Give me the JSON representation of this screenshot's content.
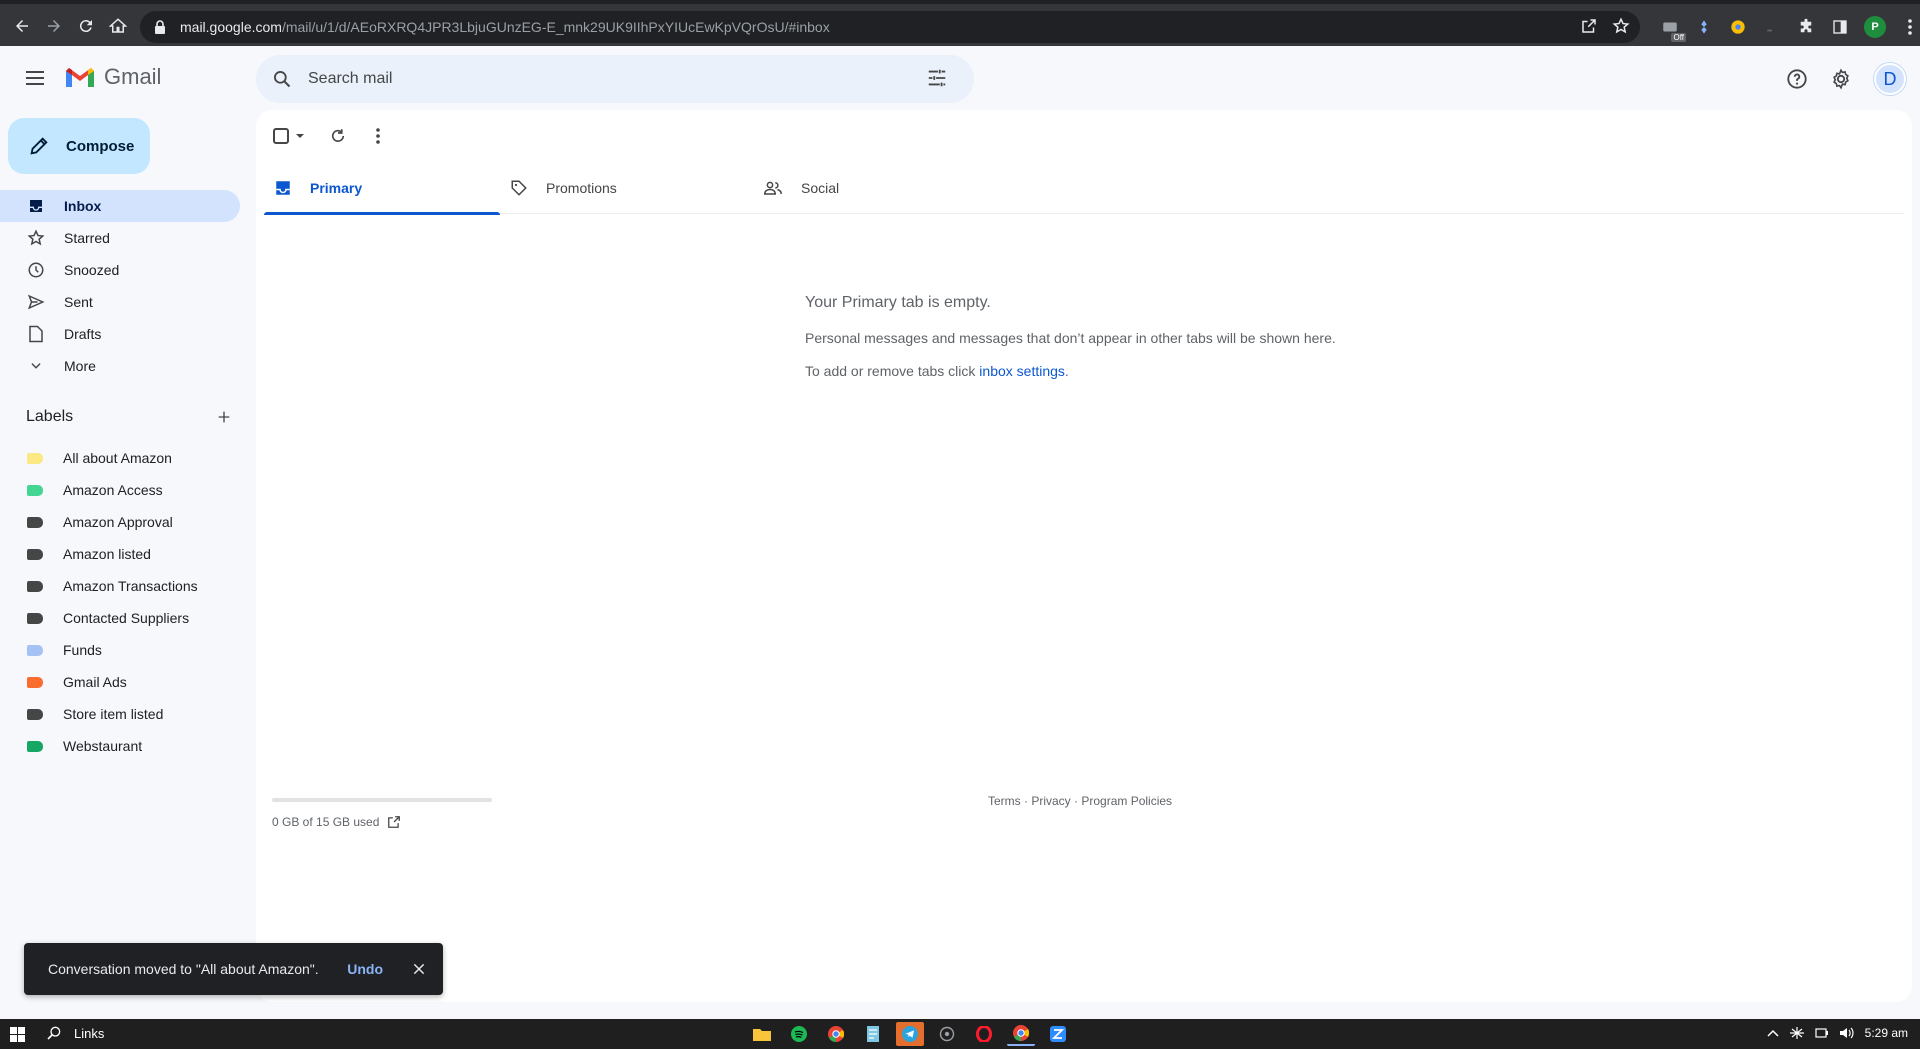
{
  "browser": {
    "url_host": "mail.google.com",
    "url_path": "/mail/u/1/d/AEoRXRQ4JPR3LbjuGUnzEG-E_mnk29UK9IIhPxYIUcEwKpVQrOsU/#inbox",
    "profile_initial": "P",
    "ext_badge": "Off"
  },
  "header": {
    "app_name": "Gmail",
    "search_placeholder": "Search mail",
    "avatar_initial": "D"
  },
  "sidebar": {
    "compose_label": "Compose",
    "items": [
      {
        "label": "Inbox",
        "icon": "inbox-icon",
        "active": true
      },
      {
        "label": "Starred",
        "icon": "star-icon"
      },
      {
        "label": "Snoozed",
        "icon": "clock-icon"
      },
      {
        "label": "Sent",
        "icon": "send-icon"
      },
      {
        "label": "Drafts",
        "icon": "draft-icon"
      },
      {
        "label": "More",
        "icon": "chevron-down-icon"
      }
    ],
    "labels_title": "Labels",
    "labels": [
      {
        "label": "All about Amazon",
        "color": "#fbe983"
      },
      {
        "label": "Amazon Access",
        "color": "#42d692"
      },
      {
        "label": "Amazon Approval",
        "color": "#444746"
      },
      {
        "label": "Amazon listed",
        "color": "#444746"
      },
      {
        "label": "Amazon Transactions",
        "color": "#444746"
      },
      {
        "label": "Contacted Suppliers",
        "color": "#444746"
      },
      {
        "label": "Funds",
        "color": "#a4c2f4"
      },
      {
        "label": "Gmail Ads",
        "color": "#fb6c2f"
      },
      {
        "label": "Store item listed",
        "color": "#444746"
      },
      {
        "label": "Webstaurant",
        "color": "#16a765"
      }
    ]
  },
  "tabs": [
    {
      "label": "Primary",
      "active": true
    },
    {
      "label": "Promotions"
    },
    {
      "label": "Social"
    }
  ],
  "empty_state": {
    "heading": "Your Primary tab is empty.",
    "line1": "Personal messages and messages that don’t appear in other tabs will be shown here.",
    "line2_prefix": "To add or remove tabs click ",
    "line2_link": "inbox settings",
    "line2_suffix": "."
  },
  "storage": {
    "text": "0 GB of 15 GB used",
    "fraction_used": 0
  },
  "footer": {
    "terms": "Terms",
    "privacy": "Privacy",
    "policies": "Program Policies",
    "separator": " · "
  },
  "snackbar": {
    "message": "Conversation moved to \"All about Amazon\".",
    "action": "Undo"
  },
  "taskbar": {
    "search_text": "Links",
    "time": "5:29 am"
  }
}
